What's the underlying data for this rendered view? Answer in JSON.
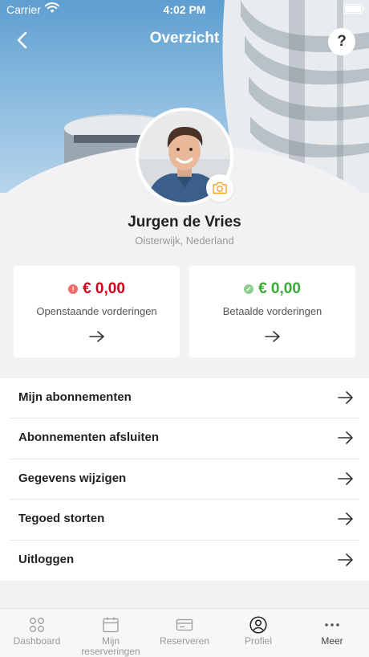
{
  "status_bar": {
    "carrier": "Carrier",
    "time": "4:02 PM"
  },
  "nav": {
    "title": "Overzicht",
    "help_label": "?"
  },
  "user": {
    "name": "Jurgen de Vries",
    "location": "Oisterwijk, Nederland"
  },
  "cards": [
    {
      "amount": "€ 0,00",
      "label": "Openstaande vorderingen",
      "status": "error",
      "color": "#d0021b"
    },
    {
      "amount": "€ 0,00",
      "label": "Betaalde vorderingen",
      "status": "success",
      "color": "#3aa935"
    }
  ],
  "menu": [
    {
      "label": "Mijn abonnementen"
    },
    {
      "label": "Abonnementen afsluiten"
    },
    {
      "label": "Gegevens wijzigen"
    },
    {
      "label": "Tegoed storten"
    },
    {
      "label": "Uitloggen"
    }
  ],
  "tabs": [
    {
      "label": "Dashboard",
      "icon": "dashboard-icon"
    },
    {
      "label": "Mijn reserveringen",
      "icon": "calendar-icon"
    },
    {
      "label": "Reserveren",
      "icon": "card-icon"
    },
    {
      "label": "Profiel",
      "icon": "profile-icon"
    },
    {
      "label": "Meer",
      "icon": "more-icon"
    }
  ]
}
